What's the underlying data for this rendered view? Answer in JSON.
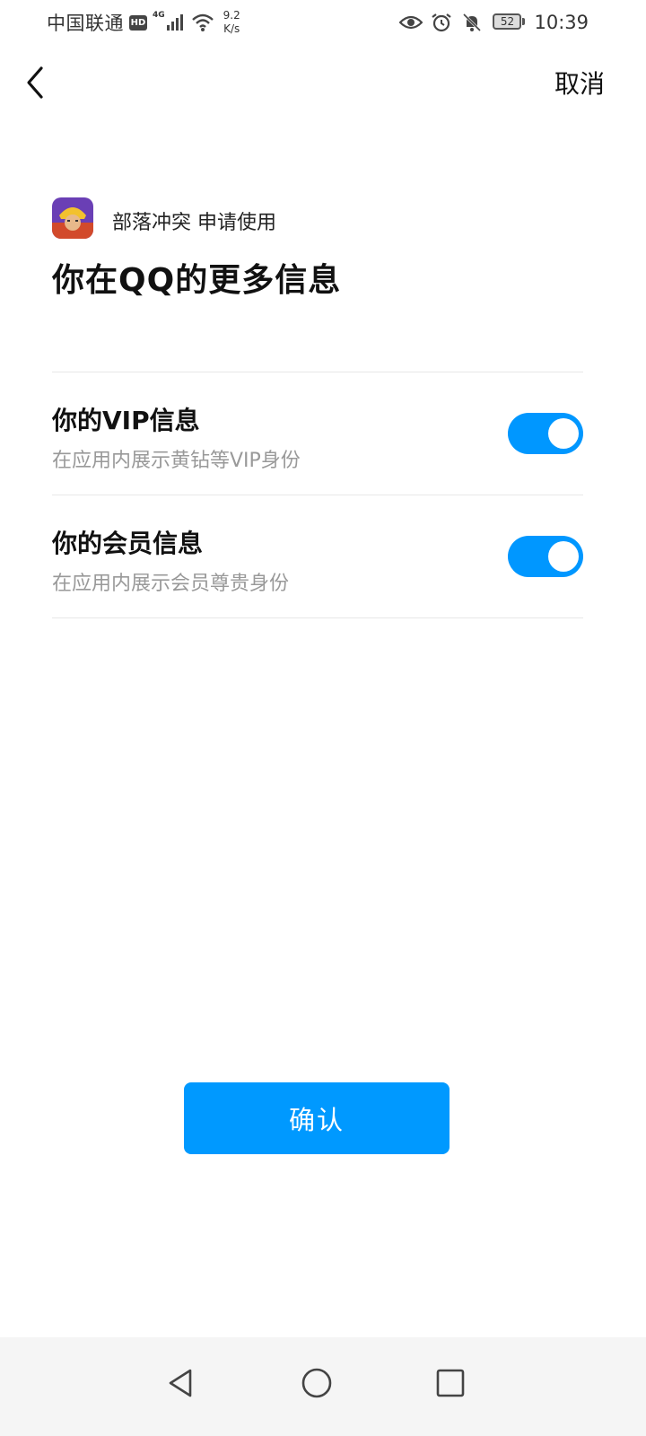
{
  "status_bar": {
    "carrier": "中国联通",
    "hd_badge": "HD",
    "network_type": "4G",
    "speed_value": "9.2",
    "speed_unit": "K/s",
    "battery_level": "52",
    "time": "10:39",
    "icons": [
      "hd-icon",
      "signal-icon",
      "wifi-icon",
      "eye-icon",
      "alarm-icon",
      "bell-off-icon",
      "battery-icon"
    ]
  },
  "header": {
    "back_icon": "chevron-left-icon",
    "cancel_label": "取消"
  },
  "app": {
    "icon": "clash-of-clans-app-icon",
    "request_text": "部落冲突 申请使用"
  },
  "page_title": "你在QQ的更多信息",
  "options": [
    {
      "title": "你的VIP信息",
      "description": "在应用内展示黄钻等VIP身份",
      "enabled": true
    },
    {
      "title": "你的会员信息",
      "description": "在应用内展示会员尊贵身份",
      "enabled": true
    }
  ],
  "confirm_label": "确认",
  "colors": {
    "accent": "#0099ff",
    "toggle_on": "#0097ff",
    "secondary_text": "#999999",
    "divider": "#e8e8e8"
  },
  "nav_bar": {
    "icons": [
      "back-triangle-icon",
      "home-circle-icon",
      "recents-square-icon"
    ]
  }
}
